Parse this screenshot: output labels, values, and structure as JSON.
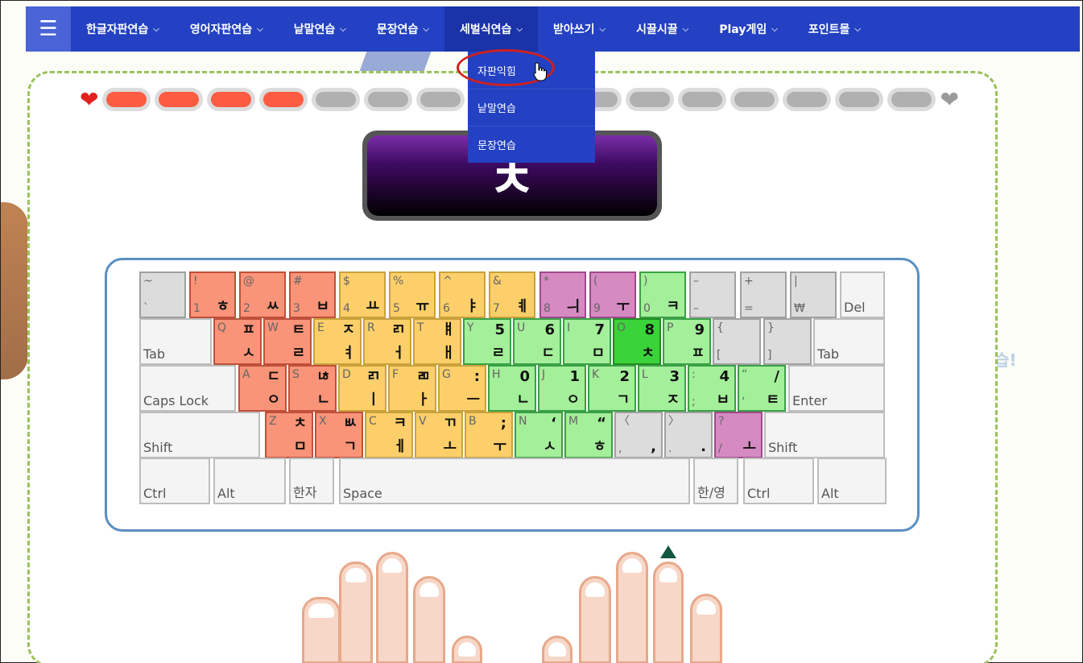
{
  "nav": {
    "menu_icon": "hamburger-icon",
    "items": [
      {
        "label": "한글자판연습"
      },
      {
        "label": "영어자판연습"
      },
      {
        "label": "낱말연습"
      },
      {
        "label": "문장연습"
      },
      {
        "label": "세벌식연습",
        "active": true
      },
      {
        "label": "받아쓰기"
      },
      {
        "label": "시끌시끌"
      },
      {
        "label": "Play게임"
      },
      {
        "label": "포인트몰"
      }
    ]
  },
  "dropdown": {
    "items": [
      {
        "label": "자판익힘",
        "highlighted": true
      },
      {
        "label": "낱말연습"
      },
      {
        "label": "문장연습"
      }
    ]
  },
  "lives": {
    "heart_full_color": "#e3201e",
    "heart_empty_color": "#9a9a9a",
    "filled": 4,
    "total": 16,
    "filled_color": "#fb5c42",
    "empty_color": "#b0b0b0"
  },
  "display": {
    "char": "ㅊ"
  },
  "side_text": "습!",
  "keyboard": {
    "rows": [
      [
        {
          "t": "~",
          "b": "`",
          "c": "gy"
        },
        {
          "t": "!",
          "b": "1",
          "k2": "ㅎ",
          "c": "or"
        },
        {
          "t": "@",
          "b": "2",
          "k2": "ㅆ",
          "c": "or"
        },
        {
          "t": "#",
          "b": "3",
          "k2": "ㅂ",
          "c": "or"
        },
        {
          "t": "$",
          "b": "4",
          "k2": "ㅛ",
          "c": "ye"
        },
        {
          "t": "%",
          "b": "5",
          "k2": "ㅠ",
          "c": "ye"
        },
        {
          "t": "^",
          "b": "6",
          "k2": "ㅑ",
          "c": "ye"
        },
        {
          "t": "&",
          "b": "7",
          "k2": "ㅖ",
          "c": "ye"
        },
        {
          "t": "*",
          "b": "8",
          "k2": "ㅢ",
          "c": "pk"
        },
        {
          "t": "(",
          "b": "9",
          "k2": "ㅜ",
          "c": "pk"
        },
        {
          "t": ")",
          "b": "0",
          "k2": "ㅋ",
          "c": "gr"
        },
        {
          "t": "–",
          "b": "–",
          "c": "gy"
        },
        {
          "t": "+",
          "b": "=",
          "c": "gy"
        },
        {
          "t": "|",
          "b": "₩",
          "c": "gy"
        },
        {
          "lbl": "Del",
          "c": "wh"
        }
      ],
      [
        {
          "lbl": "Tab",
          "c": "wh"
        },
        {
          "t": "Q",
          "k1": "ㅍ",
          "k2": "ㅅ",
          "c": "or"
        },
        {
          "t": "W",
          "k1": "ㅌ",
          "k2": "ㄹ",
          "c": "or"
        },
        {
          "t": "E",
          "k1": "ㅈ",
          "k2": "ㅕ",
          "c": "ye"
        },
        {
          "t": "R",
          "k1": "ㄺ",
          "k2": "ㅓ",
          "c": "ye"
        },
        {
          "t": "T",
          "k1": "ㅒ",
          "k2": "ㅐ",
          "c": "ye"
        },
        {
          "t": "Y",
          "k1": "5",
          "k2": "ㄹ",
          "c": "gr"
        },
        {
          "t": "U",
          "k1": "6",
          "k2": "ㄷ",
          "c": "gr"
        },
        {
          "t": "I",
          "k1": "7",
          "k2": "ㅁ",
          "c": "gr"
        },
        {
          "t": "O",
          "k1": "8",
          "k2": "ㅊ",
          "c": "dg"
        },
        {
          "t": "P",
          "k1": "9",
          "k2": "ㅍ",
          "c": "gr"
        },
        {
          "t": "{",
          "b": "[",
          "c": "gy"
        },
        {
          "t": "}",
          "b": "]",
          "c": "gy"
        },
        {
          "lbl": "Tab",
          "c": "wh"
        }
      ],
      [
        {
          "lbl": "Caps Lock",
          "c": "wh"
        },
        {
          "t": "A",
          "k1": "ㄷ",
          "k2": "ㅇ",
          "c": "or"
        },
        {
          "t": "S",
          "k1": "ㄶ",
          "k2": "ㄴ",
          "c": "or"
        },
        {
          "t": "D",
          "k1": "ㄺ",
          "k2": "ㅣ",
          "c": "ye"
        },
        {
          "t": "F",
          "k1": "ㄻ",
          "k2": "ㅏ",
          "c": "ye"
        },
        {
          "t": "G",
          "k1": ":",
          "k2": "ㅡ",
          "c": "ye"
        },
        {
          "t": "H",
          "k1": "0",
          "k2": "ㄴ",
          "c": "gr"
        },
        {
          "t": "J",
          "k1": "1",
          "k2": "ㅇ",
          "c": "gr"
        },
        {
          "t": "K",
          "k1": "2",
          "k2": "ㄱ",
          "c": "gr"
        },
        {
          "t": "L",
          "k1": "3",
          "k2": "ㅈ",
          "c": "gr"
        },
        {
          "t": ":",
          "b": ";",
          "k1": "4",
          "k2": "ㅂ",
          "c": "gr"
        },
        {
          "t": "“",
          "b": "‘",
          "k1": "/",
          "k2": "ㅌ",
          "c": "gr"
        },
        {
          "lbl": "Enter",
          "c": "wh"
        }
      ],
      [
        {
          "lbl": "Shift",
          "c": "wh"
        },
        {
          "t": "Z",
          "k1": "ㅊ",
          "k2": "ㅁ",
          "c": "or"
        },
        {
          "t": "X",
          "k1": "ㅄ",
          "k2": "ㄱ",
          "c": "or"
        },
        {
          "t": "C",
          "k1": "ㅋ",
          "k2": "ㅔ",
          "c": "ye"
        },
        {
          "t": "V",
          "k1": "ㄲ",
          "k2": "ㅗ",
          "c": "ye"
        },
        {
          "t": "B",
          "k1": ";",
          "k2": "ㅜ",
          "c": "ye"
        },
        {
          "t": "N",
          "k1": "‘",
          "k2": "ㅅ",
          "c": "gr"
        },
        {
          "t": "M",
          "k1": "“",
          "k2": "ㅎ",
          "c": "gr"
        },
        {
          "t": "〈",
          "b": ",",
          "k2": ",",
          "c": "gy"
        },
        {
          "t": "〉",
          "b": ".",
          "k2": ".",
          "c": "gy"
        },
        {
          "t": "?",
          "b": "/",
          "k2": "ㅗ",
          "c": "pk"
        },
        {
          "lbl": "Shift",
          "c": "wh"
        }
      ],
      [
        {
          "lbl": "Ctrl",
          "c": "wh"
        },
        {
          "lbl": "Alt",
          "c": "wh"
        },
        {
          "lbl": "한자",
          "c": "wh"
        },
        {
          "lbl": "Space",
          "c": "wh"
        },
        {
          "lbl": "한/영",
          "c": "wh"
        },
        {
          "lbl": "Ctrl",
          "c": "wh"
        },
        {
          "lbl": "Alt",
          "c": "wh"
        }
      ]
    ]
  }
}
